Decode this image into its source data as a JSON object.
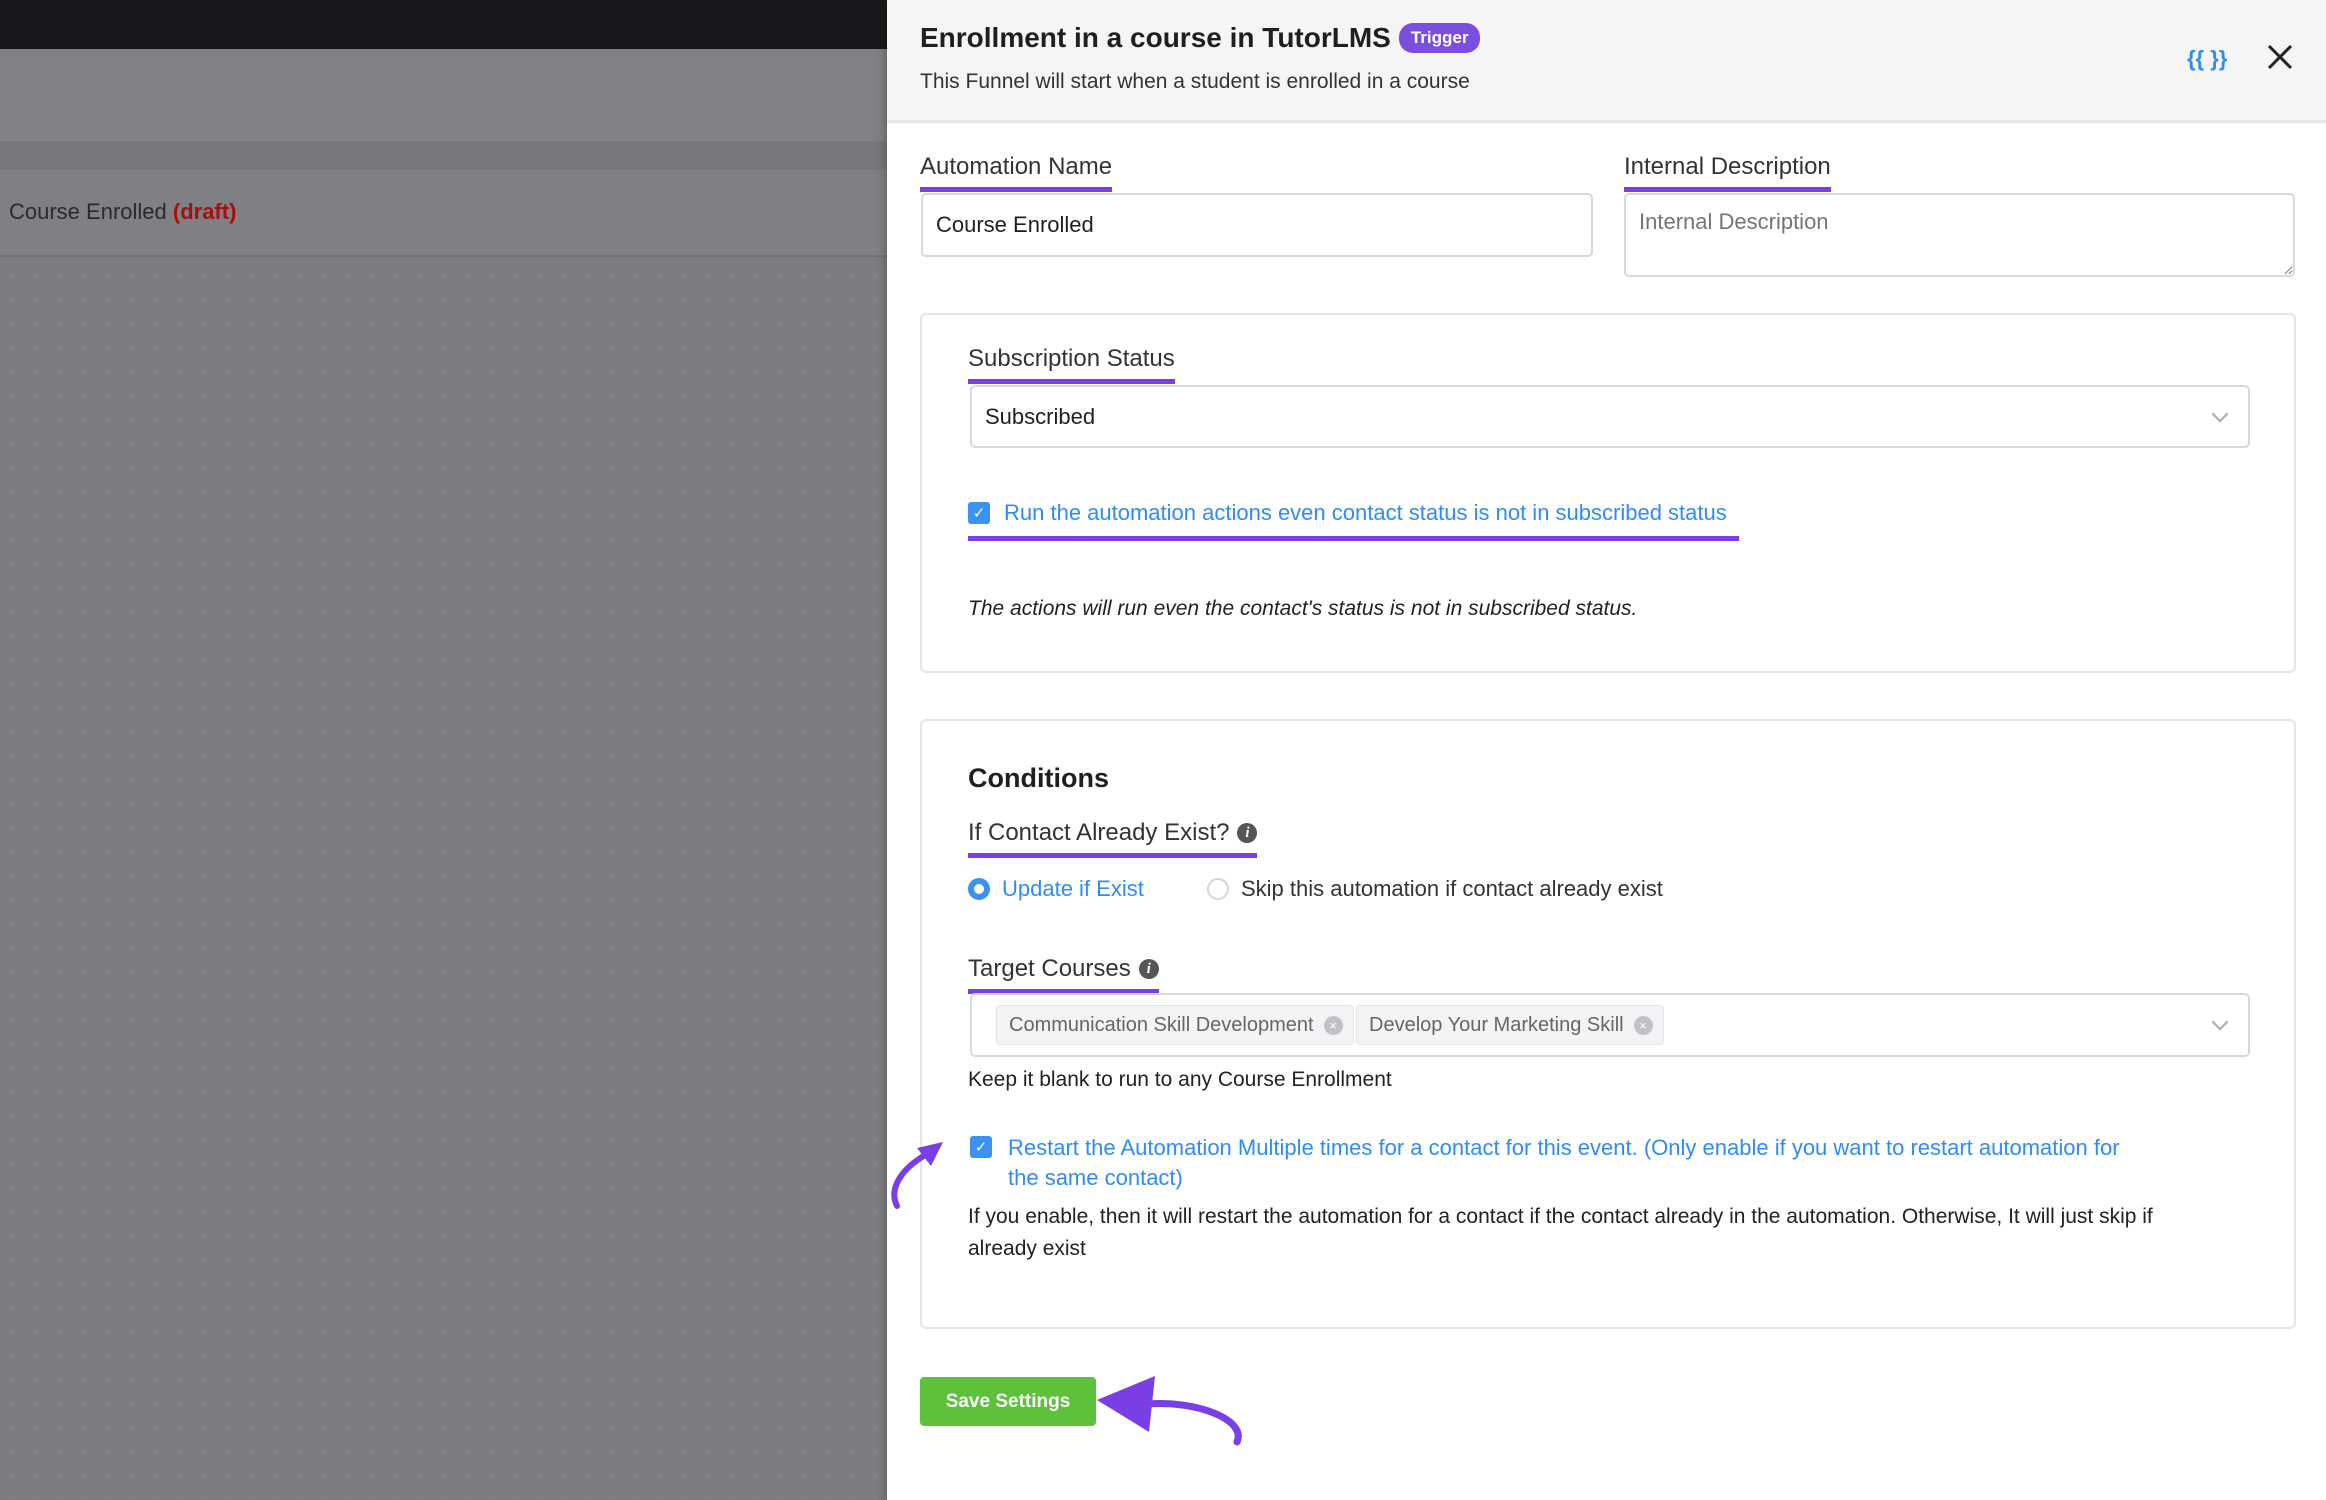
{
  "background": {
    "breadcrumb_name": "Course Enrolled",
    "breadcrumb_status": "(draft)"
  },
  "header": {
    "title": "Enrollment in a course in TutorLMS",
    "badge": "Trigger",
    "subtitle": "This Funnel will start when a student is enrolled in a course",
    "smartcodes_icon": "{{ }}",
    "close_icon": "close-icon"
  },
  "form": {
    "automation_name": {
      "label": "Automation Name",
      "value": "Course Enrolled"
    },
    "internal_description": {
      "label": "Internal Description",
      "placeholder": "Internal Description",
      "value": ""
    },
    "subscription": {
      "label": "Subscription Status",
      "selected": "Subscribed",
      "checkbox_label": "Run the automation actions even contact status is not in subscribed status",
      "checkbox_checked": true,
      "help": "The actions will run even the contact's status is not in subscribed status."
    },
    "conditions": {
      "heading": "Conditions",
      "contact_exist": {
        "label": "If Contact Already Exist?",
        "options": [
          {
            "label": "Update if Exist",
            "selected": true
          },
          {
            "label": "Skip this automation if contact already exist",
            "selected": false
          }
        ]
      },
      "target_courses": {
        "label": "Target Courses",
        "tags": [
          "Communication Skill Development",
          "Develop Your Marketing Skill"
        ],
        "help": "Keep it blank to run to any Course Enrollment"
      },
      "restart": {
        "checked": true,
        "label_line1": "Restart the Automation Multiple times for a contact for this event. (Only enable if you want to restart automation for",
        "label_line2": "the same contact)",
        "help_line1": "If you enable, then it will restart the automation for a contact if the contact already in the automation. Otherwise, It will just skip if",
        "help_line2": "already exist"
      }
    },
    "save_label": "Save Settings"
  },
  "colors": {
    "accent": "#7a3fe4",
    "link": "#2f8cf5",
    "save": "#5ec13b",
    "draft": "#a50f0f"
  }
}
